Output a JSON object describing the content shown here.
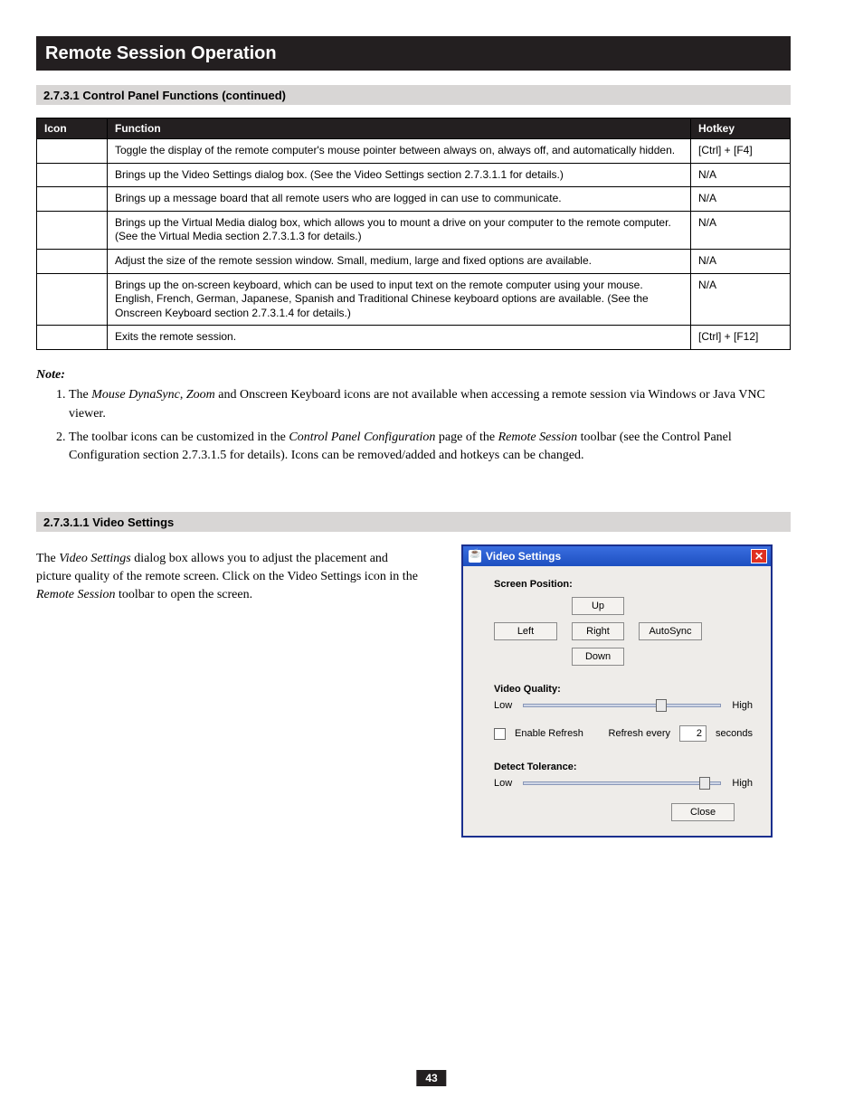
{
  "titleBar": "Remote Session Operation",
  "sections": {
    "controlPanelFunctions": "2.7.3.1 Control Panel Functions (continued)",
    "videoSettings": "2.7.3.1.1 Video Settings"
  },
  "table": {
    "headers": {
      "icon": "Icon",
      "function": "Function",
      "hotkey": "Hotkey"
    },
    "rows": [
      {
        "icon": "",
        "function": "Toggle the display of the remote computer's mouse pointer between always on, always off, and automatically hidden.",
        "hotkey": "[Ctrl] + [F4]"
      },
      {
        "icon": "",
        "function": "Brings up the Video Settings dialog box. (See the Video Settings section 2.7.3.1.1 for details.)",
        "hotkey": "N/A"
      },
      {
        "icon": "",
        "function": "Brings up a message board that all remote users who are logged in can use to communicate.",
        "hotkey": "N/A"
      },
      {
        "icon": "",
        "function": "Brings up the Virtual Media dialog box, which allows you to mount a drive on your computer to the remote computer. (See the Virtual Media section 2.7.3.1.3 for details.)",
        "hotkey": "N/A"
      },
      {
        "icon": "",
        "function": "Adjust the size of the remote session window. Small, medium, large and fixed options are available.",
        "hotkey": "N/A"
      },
      {
        "icon": "",
        "function": "Brings up the on-screen keyboard, which can be used to input text on the remote computer using your mouse. English, French, German, Japanese, Spanish and Traditional Chinese keyboard options are available. (See the Onscreen Keyboard section 2.7.3.1.4 for details.)",
        "hotkey": "N/A"
      },
      {
        "icon": "",
        "function": "Exits the remote session.",
        "hotkey": "[Ctrl] + [F12]"
      }
    ]
  },
  "notesLabel": "Note:",
  "notes": [
    {
      "pre": "The ",
      "em1": "Mouse DynaSync",
      "mid": ", ",
      "em2": "Zoom",
      "post": " and Onscreen Keyboard icons are not available when accessing a remote session via Windows or Java VNC viewer."
    },
    {
      "pre": "The toolbar icons can be customized in the ",
      "em1": "Control Panel Configuration",
      "mid": " page of the ",
      "em2": "Remote Session",
      "post": " toolbar (see the Control Panel Configuration section 2.7.3.1.5 for details). Icons can be removed/added and hotkeys can be changed."
    }
  ],
  "videoTextLines": [
    {
      "pre": "The ",
      "em": "Video Settings",
      "post": " dialog box allows you to adjust the placement and"
    },
    "picture quality of the remote screen. Click on the Video Settings icon in the",
    {
      "em": "Remote Session",
      "post": " toolbar to open the screen."
    }
  ],
  "dialog": {
    "title": "Video Settings",
    "titleIconName": "java-icon",
    "closeGlyph": "✕",
    "screenPositionLabel": "Screen Position:",
    "buttons": {
      "up": "Up",
      "left": "Left",
      "right": "Right",
      "autosync": "AutoSync",
      "down": "Down",
      "close": "Close"
    },
    "videoQualityLabel": "Video Quality:",
    "low": "Low",
    "high": "High",
    "enableRefresh": "Enable Refresh",
    "refreshEveryPre": "Refresh every",
    "refreshValue": "2",
    "refreshUnit": "seconds",
    "detectToleranceLabel": "Detect Tolerance:",
    "videoQualityPercent": 70,
    "detectTolerancePercent": 92
  },
  "pageNumber": "43"
}
